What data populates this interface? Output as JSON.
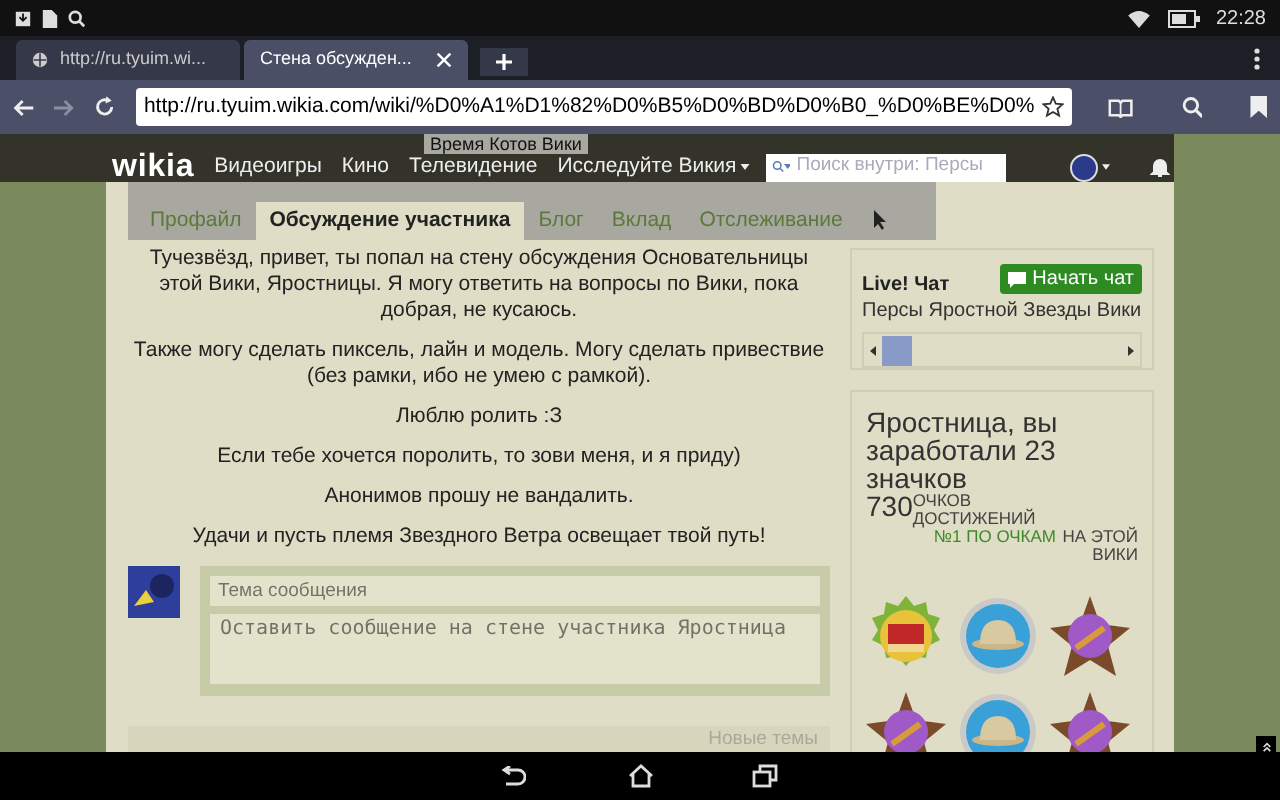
{
  "status_bar": {
    "time": "22:28"
  },
  "browser": {
    "tabs": [
      {
        "title": "http://ru.tyuim.wi...",
        "selected": false
      },
      {
        "title": "Стена обсужден...",
        "selected": true
      }
    ],
    "address": "http://ru.tyuim.wikia.com/wiki/%D0%A1%D1%82%D0%B5%D0%BD%D0%B0_%D0%BE%D0%"
  },
  "wikia_nav": {
    "logo": "wikia",
    "items": [
      "Видеоигры",
      "Кино",
      "Телевидение"
    ],
    "explore": "Исследуйте Викия",
    "search_placeholder": "Поиск внутри: Персы",
    "wiki_title": "Время Котов Вики"
  },
  "profile_tabs": [
    {
      "label": "Профайл",
      "selected": false
    },
    {
      "label": "Обсуждение участника",
      "selected": true
    },
    {
      "label": "Блог",
      "selected": false
    },
    {
      "label": "Вклад",
      "selected": false
    },
    {
      "label": "Отслеживание",
      "selected": false
    }
  ],
  "wall_intro": [
    "Тучезвёзд, привет, ты попал на стену обсуждения Основательницы этой Вики, Яростницы. Я могу ответить на вопросы по Вики, пока добрая, не кусаюсь.",
    "Также могу сделать пиксель, лайн и модель. Могу сделать привествие (без рамки, ибо не умею с рамкой).",
    "Люблю ролить :З",
    "Если тебе хочется поролить, то зови меня, и я приду)",
    "Анонимов прошу не вандалить.",
    "Удачи и пусть племя Звездного Ветра освещает твой путь!"
  ],
  "message_form": {
    "title_placeholder": "Тема сообщения",
    "body_placeholder": "Оставить сообщение на стене участника Яростница"
  },
  "new_topics": "Новые темы",
  "chat": {
    "heading": "Live! Чат",
    "button": "Начать чат",
    "wiki": "Персы Яростной Звезды Вики"
  },
  "achievements": {
    "heading": "Яростница, вы заработали 23 значков",
    "points": "730",
    "points_label": "ОЧКОВ ДОСТИЖЕНИЙ",
    "rank": "№1 ПО ОЧКАМ",
    "rank_scope": "НА ЭТОЙ ВИКИ"
  }
}
